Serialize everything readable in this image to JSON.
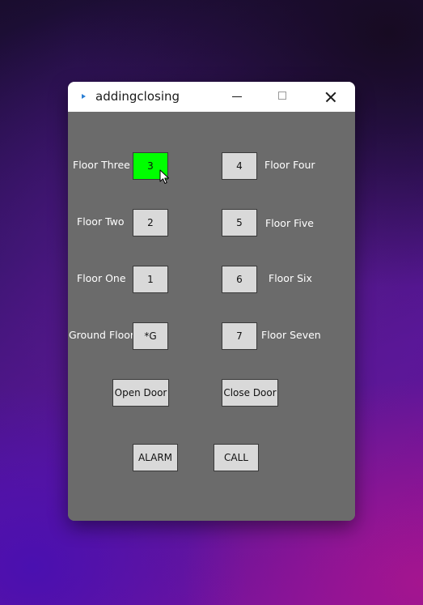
{
  "window": {
    "title": "addingclosing"
  },
  "floors": {
    "three": {
      "label": "Floor Three",
      "button": "3"
    },
    "two": {
      "label": "Floor Two",
      "button": "2"
    },
    "one": {
      "label": "Floor One",
      "button": "1"
    },
    "ground": {
      "label": "Ground Floor",
      "button": "*G"
    },
    "four": {
      "label": "Floor Four",
      "button": "4"
    },
    "five": {
      "label": "Floor Five",
      "button": "5"
    },
    "six": {
      "label": "Floor Six",
      "button": "6"
    },
    "seven": {
      "label": "Floor Seven",
      "button": "7"
    }
  },
  "doors": {
    "open": "Open Door",
    "close": "Close Door"
  },
  "alarm": "ALARM",
  "call": "CALL",
  "colors": {
    "active_floor": "#00ff00",
    "button_bg": "#d9d9d9",
    "panel_bg": "#6b6b6b"
  },
  "active_floor": "3"
}
